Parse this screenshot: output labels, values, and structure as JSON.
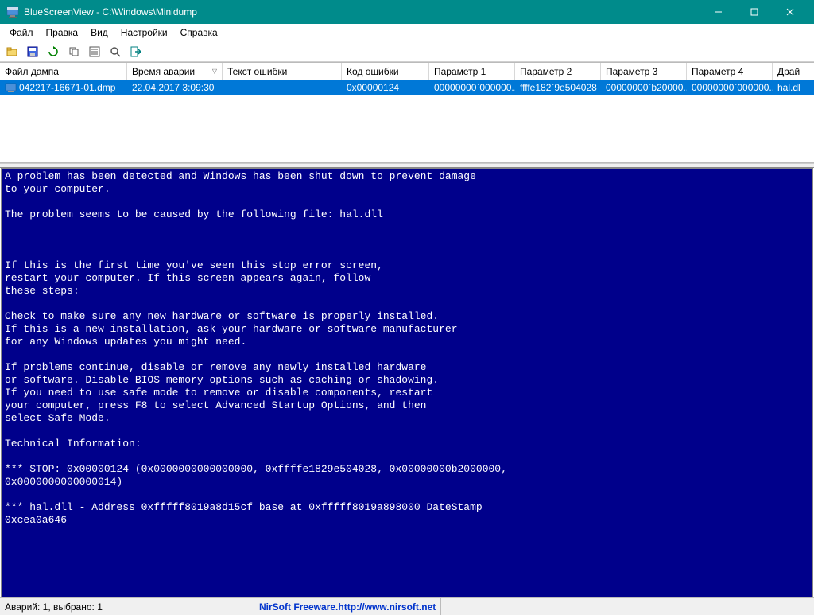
{
  "window": {
    "title": "BlueScreenView - C:\\Windows\\Minidump"
  },
  "menu": {
    "file": "Файл",
    "edit": "Правка",
    "view": "Вид",
    "settings": "Настройки",
    "help": "Справка"
  },
  "columns": {
    "dump_file": "Файл дампа",
    "crash_time": "Время аварии",
    "error_text": "Текст ошибки",
    "error_code": "Код ошибки",
    "param1": "Параметр 1",
    "param2": "Параметр 2",
    "param3": "Параметр 3",
    "param4": "Параметр 4",
    "driver": "Драй"
  },
  "rows": [
    {
      "dump_file": "042217-16671-01.dmp",
      "crash_time": "22.04.2017 3:09:30",
      "error_text": "",
      "error_code": "0x00000124",
      "param1": "00000000`000000...",
      "param2": "ffffe182`9e504028",
      "param3": "00000000`b20000...",
      "param4": "00000000`000000...",
      "driver": "hal.dl"
    }
  ],
  "bsod_text": "A problem has been detected and Windows has been shut down to prevent damage\nto your computer.\n\nThe problem seems to be caused by the following file: hal.dll\n\n\n\nIf this is the first time you've seen this stop error screen,\nrestart your computer. If this screen appears again, follow\nthese steps:\n\nCheck to make sure any new hardware or software is properly installed.\nIf this is a new installation, ask your hardware or software manufacturer\nfor any Windows updates you might need.\n\nIf problems continue, disable or remove any newly installed hardware\nor software. Disable BIOS memory options such as caching or shadowing.\nIf you need to use safe mode to remove or disable components, restart\nyour computer, press F8 to select Advanced Startup Options, and then\nselect Safe Mode.\n\nTechnical Information:\n\n*** STOP: 0x00000124 (0x0000000000000000, 0xffffe1829e504028, 0x00000000b2000000,\n0x0000000000000014)\n\n*** hal.dll - Address 0xfffff8019a8d15cf base at 0xfffff8019a898000 DateStamp\n0xcea0a646",
  "statusbar": {
    "left": "Аварий: 1, выбрано: 1",
    "brand": "NirSoft Freeware. ",
    "url": "http://www.nirsoft.net"
  }
}
